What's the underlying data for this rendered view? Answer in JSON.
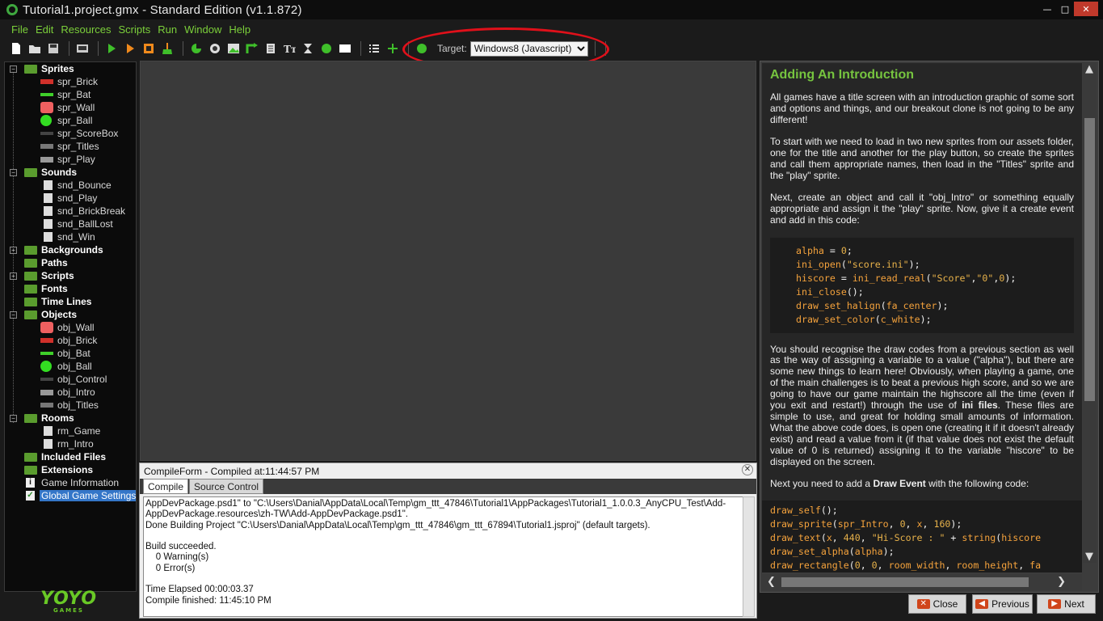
{
  "window": {
    "title": "Tutorial1.project.gmx  -  Standard Edition (v1.1.872)",
    "min": "—",
    "max": "□",
    "close": "✕"
  },
  "menu": [
    {
      "label": "File"
    },
    {
      "label": "Edit"
    },
    {
      "label": "Resources"
    },
    {
      "label": "Scripts"
    },
    {
      "label": "Run"
    },
    {
      "label": "Window"
    },
    {
      "label": "Help"
    }
  ],
  "toolbar": {
    "target_label": "Target:",
    "target_value": "Windows8 (Javascript)"
  },
  "tree": {
    "sprites": "Sprites",
    "spr_brick": "spr_Brick",
    "spr_bat": "spr_Bat",
    "spr_wall": "spr_Wall",
    "spr_ball": "spr_Ball",
    "spr_scorebox": "spr_ScoreBox",
    "spr_titles": "spr_Titles",
    "spr_play": "spr_Play",
    "sounds": "Sounds",
    "snd_bounce": "snd_Bounce",
    "snd_play": "snd_Play",
    "snd_brickbreak": "snd_BrickBreak",
    "snd_balllost": "snd_BallLost",
    "snd_win": "snd_Win",
    "backgrounds": "Backgrounds",
    "paths": "Paths",
    "scripts": "Scripts",
    "fonts": "Fonts",
    "timelines": "Time Lines",
    "objects": "Objects",
    "obj_wall": "obj_Wall",
    "obj_brick": "obj_Brick",
    "obj_bat": "obj_Bat",
    "obj_ball": "obj_Ball",
    "obj_control": "obj_Control",
    "obj_intro": "obj_Intro",
    "obj_titles": "obj_Titles",
    "rooms": "Rooms",
    "rm_game": "rm_Game",
    "rm_intro": "rm_Intro",
    "included": "Included Files",
    "extensions": "Extensions",
    "gameinfo": "Game Information",
    "globalsettings": "Global Game Settings"
  },
  "logo": {
    "text": "YOYO",
    "sub": "GAMES"
  },
  "compile": {
    "title": "CompileForm - Compiled at:11:44:57 PM",
    "tab1": "Compile",
    "tab2": "Source Control",
    "lines": [
      "AppDevPackage.psd1\" to \"C:\\Users\\Danial\\AppData\\Local\\Temp\\gm_ttt_47846\\Tutorial1\\AppPackages\\Tutorial1_1.0.0.3_AnyCPU_Test\\Add-",
      "AppDevPackage.resources\\zh-TW\\Add-AppDevPackage.psd1\".",
      "Done Building Project \"C:\\Users\\Danial\\AppData\\Local\\Temp\\gm_ttt_47846\\gm_ttt_67894\\Tutorial1.jsproj\" (default targets).",
      "",
      "Build succeeded.",
      "    0 Warning(s)",
      "    0 Error(s)",
      "",
      "Time Elapsed 00:00:03.37",
      "Compile finished: 11:45:10 PM"
    ]
  },
  "help": {
    "heading": "Adding An Introduction",
    "p1": "All games have a title screen with an introduction graphic of some sort and options and things, and our breakout clone is not going to be any different!",
    "p2": "To start with we need to load in two new sprites from our assets folder, one for the title and another for the play button, so create the sprites and call them appropriate names, then load in the \"Titles\" sprite and the \"play\" sprite.",
    "p3": "Next, create an object and call it \"obj_Intro\" or something equally appropriate and assign it the \"play\" sprite. Now, give it a create event and add in this code:",
    "p4a": "You should recognise the draw codes from a previous section as well as the way of assigning a variable to a value (\"alpha\"), but there are some new things to learn here! Obviously, when playing a game, one of the main challenges is to beat a previous high score, and so we are going to have our game maintain the highscore all the time (even if you exit and restart!) through the use of ",
    "p4bold": "ini files",
    "p4b": ". These files are simple to use, and great for holding small amounts of information. What the above code does, is open one (creating it if it doesn't already exist) and read a value from it (if that value does not exist the default value of 0 is returned) assigning it to the variable \"hiscore\" to be displayed on the screen.",
    "p5a": "Next you need to add a ",
    "p5bold": "Draw Event",
    "p5b": " with the following code:"
  },
  "buttons": {
    "close": "Close",
    "previous": "Previous",
    "next": "Next"
  },
  "colors": {
    "menu_text": "#7bcf3a",
    "heading": "#76c43f",
    "highlight": "#e0101a"
  }
}
